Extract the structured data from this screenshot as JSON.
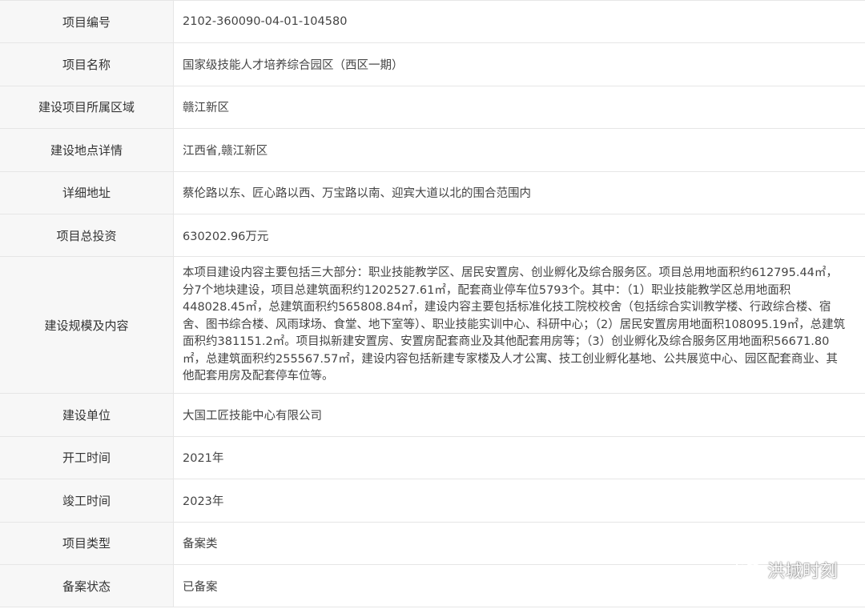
{
  "rows": [
    {
      "label": "项目编号",
      "value": "2102-360090-04-01-104580"
    },
    {
      "label": "项目名称",
      "value": "国家级技能人才培养综合园区（西区一期）"
    },
    {
      "label": "建设项目所属区域",
      "value": "赣江新区"
    },
    {
      "label": "建设地点详情",
      "value": "江西省,赣江新区"
    },
    {
      "label": "详细地址",
      "value": "蔡伦路以东、匠心路以西、万宝路以南、迎宾大道以北的围合范围内"
    },
    {
      "label": "项目总投资",
      "value": "630202.96万元"
    },
    {
      "label": "建设规模及内容",
      "value": "本项目建设内容主要包括三大部分：职业技能教学区、居民安置房、创业孵化及综合服务区。项目总用地面积约612795.44㎡，分7个地块建设，项目总建筑面积约1202527.61㎡，配套商业停车位5793个。其中：（1）职业技能教学区总用地面积448028.45㎡，总建筑面积约565808.84㎡，建设内容主要包括标准化技工院校校舍（包括综合实训教学楼、行政综合楼、宿舍、图书综合楼、风雨球场、食堂、地下室等）、职业技能实训中心、科研中心；（2）居民安置房用地面积108095.19㎡，总建筑面积约381151.2㎡。项目拟新建安置房、安置房配套商业及其他配套用房等；（3）创业孵化及综合服务区用地面积56671.80㎡，总建筑面积约255567.57㎡，建设内容包括新建专家楼及人才公寓、技工创业孵化基地、公共展览中心、园区配套商业、其他配套用房及配套停车位等。"
    },
    {
      "label": "建设单位",
      "value": "大国工匠技能中心有限公司"
    },
    {
      "label": "开工时间",
      "value": "2021年"
    },
    {
      "label": "竣工时间",
      "value": "2023年"
    },
    {
      "label": "项目类型",
      "value": "备案类"
    },
    {
      "label": "备案状态",
      "value": "已备案"
    }
  ],
  "watermark": {
    "text": "洪城时刻",
    "icon": "wechat-icon"
  }
}
